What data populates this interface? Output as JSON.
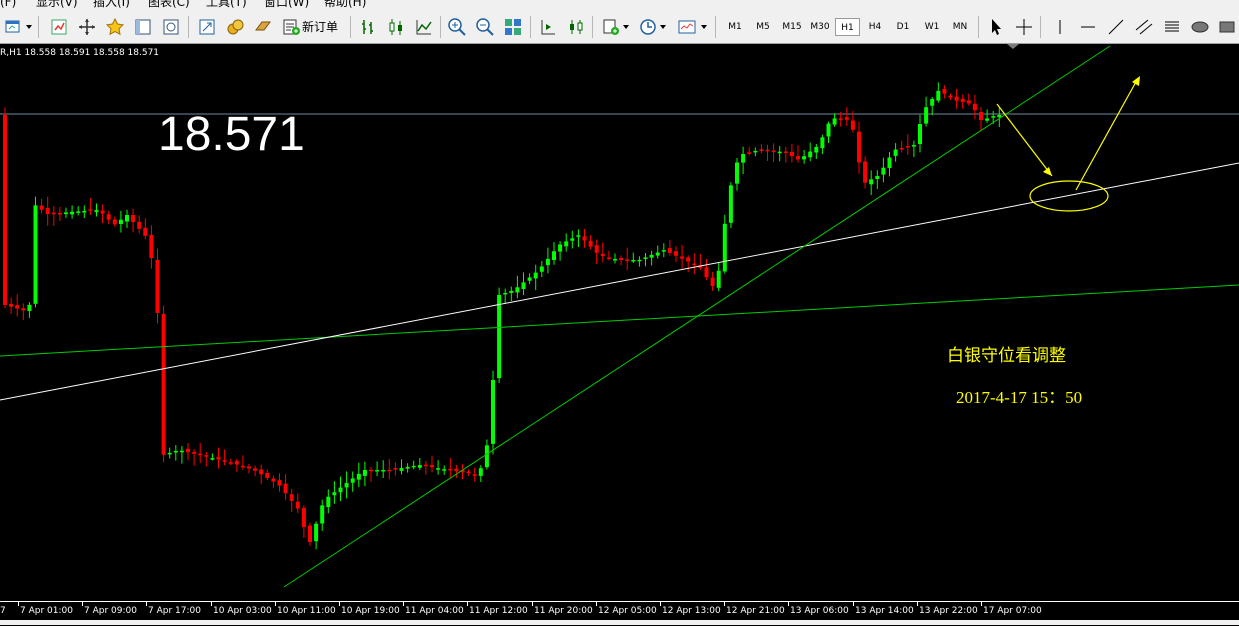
{
  "menu": {
    "items": [
      {
        "label": "(F)"
      },
      {
        "label": "显示(V)"
      },
      {
        "label": "插入(I)"
      },
      {
        "label": "图表(C)"
      },
      {
        "label": "工具(T)"
      },
      {
        "label": "窗口(W)"
      },
      {
        "label": "帮助(H)"
      }
    ]
  },
  "toolbar": {
    "new_order_label": "新订单",
    "timeframes": [
      "M1",
      "M5",
      "M15",
      "M30",
      "H1",
      "H4",
      "D1",
      "W1",
      "MN"
    ],
    "active_timeframe": "H1",
    "icons": [
      "new-chart-icon",
      "profiles-icon",
      "market-watch-icon",
      "navigator-icon",
      "favorites-icon",
      "data-window-icon",
      "zoom-chart-icon",
      "strategy-tester-icon",
      "history-icon",
      "new-order-icon",
      "bar-chart-icon",
      "candlestick-icon",
      "line-chart-icon",
      "zoom-in-icon",
      "zoom-out-icon",
      "tile-windows-icon",
      "auto-scroll-icon",
      "chart-shift-icon",
      "indicators-icon",
      "periods-icon",
      "templates-icon",
      "cursor-icon",
      "crosshair-icon",
      "vertical-line-icon",
      "horizontal-line-icon",
      "trendline-icon",
      "equidistant-channel-icon",
      "fibonacci-icon",
      "text-icon",
      "ellipse-icon",
      "rectangle-icon"
    ]
  },
  "chart": {
    "info": "R,H1  18.558 18.591 18.558 18.571",
    "current_price": "18.571",
    "annotation_title": "白银守位看调整",
    "annotation_date": "2017-4-17  15：50",
    "colors": {
      "background": "#000000",
      "bull": "#00ff00",
      "bear": "#ff0000",
      "trendline_green": "#00cc00",
      "trendline_white": "#ffffff",
      "annotation": "#ffff00",
      "price_line": "#6c8c9c"
    },
    "x_labels": [
      "7 Apr 01:00",
      "7 Apr 09:00",
      "7 Apr 17:00",
      "10 Apr 03:00",
      "10 Apr 11:00",
      "10 Apr 19:00",
      "11 Apr 04:00",
      "11 Apr 12:00",
      "11 Apr 20:00",
      "12 Apr 05:00",
      "12 Apr 13:00",
      "12 Apr 21:00",
      "13 Apr 06:00",
      "13 Apr 14:00",
      "13 Apr 22:00",
      "17 Apr 07:00"
    ],
    "x_label_leading": "7"
  }
}
